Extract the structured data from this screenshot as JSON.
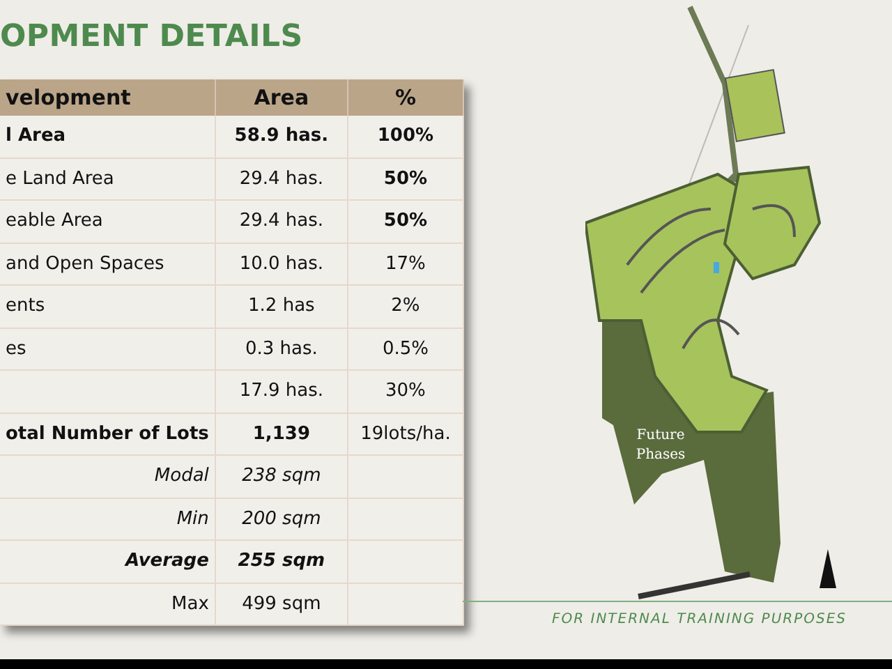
{
  "title": "OPMENT DETAILS",
  "table": {
    "columns": [
      "velopment",
      "Area",
      "%"
    ],
    "rows": [
      {
        "kind": "normal",
        "cells": [
          {
            "text": "l Area",
            "bold": true
          },
          {
            "text": "58.9 has.",
            "bold": true
          },
          {
            "text": "100%",
            "bold": true
          }
        ]
      },
      {
        "kind": "normal",
        "cells": [
          {
            "text": "e Land Area"
          },
          {
            "text": "29.4 has."
          },
          {
            "text": "50%",
            "bold": true
          }
        ]
      },
      {
        "kind": "normal",
        "cells": [
          {
            "text": "eable Area"
          },
          {
            "text": "29.4 has."
          },
          {
            "text": "50%",
            "bold": true
          }
        ]
      },
      {
        "kind": "normal",
        "cells": [
          {
            "text": "and Open Spaces"
          },
          {
            "text": "10.0 has."
          },
          {
            "text": "17%"
          }
        ]
      },
      {
        "kind": "normal",
        "cells": [
          {
            "text": "ents"
          },
          {
            "text": "1.2 has"
          },
          {
            "text": "2%"
          }
        ]
      },
      {
        "kind": "normal",
        "cells": [
          {
            "text": "es"
          },
          {
            "text": "0.3 has."
          },
          {
            "text": "0.5%"
          }
        ]
      },
      {
        "kind": "normal",
        "cells": [
          {},
          {
            "text": "17.9 has."
          },
          {
            "text": "30%"
          }
        ]
      },
      {
        "kind": "normal",
        "cells": [
          {
            "text": "otal Number of Lots",
            "bold": true
          },
          {
            "text": "1,139",
            "bold": true
          },
          {
            "text": "19lots/ha."
          }
        ]
      },
      {
        "kind": "stat",
        "cells": [
          {
            "text": "Modal",
            "italic": true
          },
          {
            "text": "238 sqm",
            "italic": true
          },
          {}
        ]
      },
      {
        "kind": "stat",
        "cells": [
          {
            "text": "Min",
            "italic": true
          },
          {
            "text": "200 sqm",
            "italic": true
          },
          {}
        ]
      },
      {
        "kind": "stat",
        "cells": [
          {
            "text": "Average",
            "italic": true,
            "bold": true
          },
          {
            "text": "255 sqm",
            "italic": true,
            "bold": true
          },
          {}
        ]
      },
      {
        "kind": "stat",
        "cells": [
          {
            "text": "Max"
          },
          {
            "text": "499 sqm"
          },
          {}
        ]
      }
    ]
  },
  "map": {
    "label": "Future Phases"
  },
  "footer": "FOR INTERNAL TRAINING PURPOSES"
}
